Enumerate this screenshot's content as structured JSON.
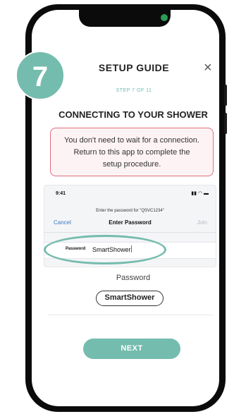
{
  "step_badge": "7",
  "header": {
    "title": "SETUP GUIDE",
    "close": "×",
    "step": "STEP 7 OF 11"
  },
  "heading": "CONNECTING TO YOUR SHOWER",
  "warning": {
    "line1": "You don't need to wait for a connection.",
    "line2": "Return to this app to complete the",
    "line3": "setup procedure."
  },
  "ios": {
    "time": "9:41",
    "status_icons": "▮▮ ◠ ▬",
    "prompt": "Enter the password for \"QSVC1234\"",
    "cancel": "Cancel",
    "title": "Enter Password",
    "join": "Join",
    "field_label": "Password",
    "field_value": "SmartShower"
  },
  "password": {
    "label": "Password",
    "value": "SmartShower"
  },
  "next_label": "NEXT",
  "colors": {
    "accent": "#74bcae",
    "warning_border": "#e06f7d",
    "ios_link": "#3a78c9"
  }
}
